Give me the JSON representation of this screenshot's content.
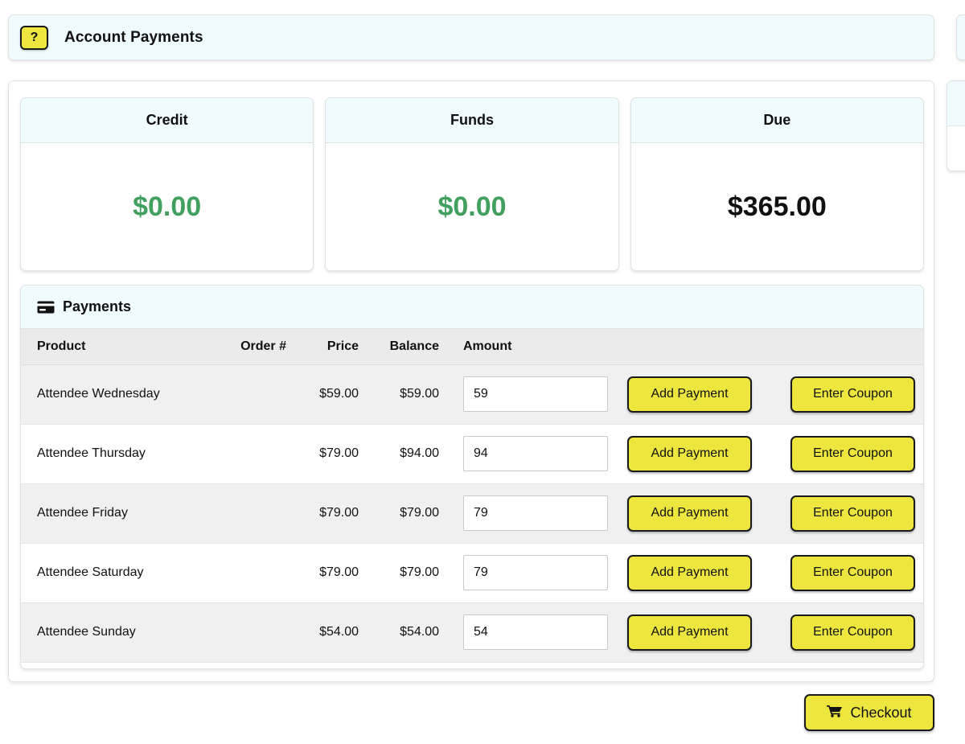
{
  "header": {
    "help_label": "?",
    "title": "Account Payments"
  },
  "summary": {
    "cards": [
      {
        "label": "Credit",
        "value": "$0.00",
        "color": "#42a05f"
      },
      {
        "label": "Funds",
        "value": "$0.00",
        "color": "#42a05f"
      },
      {
        "label": "Due",
        "value": "$365.00",
        "color": "#111111"
      }
    ]
  },
  "payments": {
    "panel_title": "Payments",
    "panel_icon": "credit-card-icon",
    "columns": [
      "Product",
      "Order #",
      "Price",
      "Balance",
      "Amount"
    ],
    "rows": [
      {
        "product": "Attendee Wednesday",
        "order": "",
        "price": "$59.00",
        "balance": "$59.00",
        "amount": "59",
        "amount_placeholder": "",
        "add_label": "Add Payment",
        "coupon_label": "Enter Coupon"
      },
      {
        "product": "Attendee Thursday",
        "order": "",
        "price": "$79.00",
        "balance": "$94.00",
        "amount": "94",
        "amount_placeholder": "",
        "add_label": "Add Payment",
        "coupon_label": "Enter Coupon"
      },
      {
        "product": "Attendee Friday",
        "order": "",
        "price": "$79.00",
        "balance": "$79.00",
        "amount": "79",
        "amount_placeholder": "",
        "add_label": "Add Payment",
        "coupon_label": "Enter Coupon"
      },
      {
        "product": "Attendee Saturday",
        "order": "",
        "price": "$79.00",
        "balance": "$79.00",
        "amount": "79",
        "amount_placeholder": "",
        "add_label": "Add Payment",
        "coupon_label": "Enter Coupon"
      },
      {
        "product": "Attendee Sunday",
        "order": "",
        "price": "$54.00",
        "balance": "$54.00",
        "amount": "54",
        "amount_placeholder": "",
        "add_label": "Add Payment",
        "coupon_label": "Enter Coupon"
      }
    ]
  },
  "footer": {
    "checkout_label": "Checkout",
    "checkout_icon": "shopping-cart-icon"
  },
  "theme": {
    "accent_yellow": "#ece63f",
    "panel_header_bg": "#f0fbfd",
    "positive_green": "#42a05f",
    "row_alt_bg": "#f0f0f0",
    "table_header_bg": "#ebebeb"
  }
}
